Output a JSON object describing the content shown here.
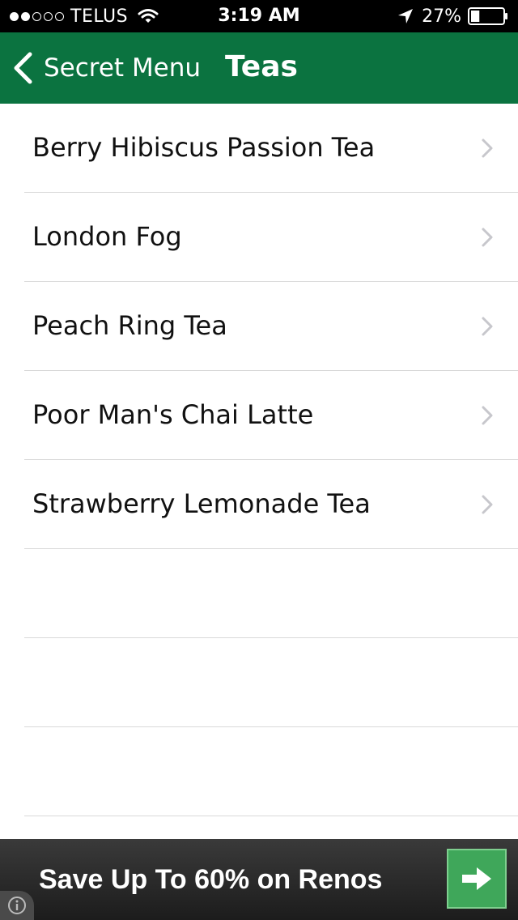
{
  "status_bar": {
    "signal_full": 2,
    "signal_total": 5,
    "carrier": "TELUS",
    "time": "3:19 AM",
    "battery_percent": "27%",
    "battery_level": 0.27,
    "icons": [
      "wifi-icon",
      "location-arrow-icon",
      "battery-icon"
    ]
  },
  "nav": {
    "back_label": "Secret Menu",
    "title": "Teas",
    "color": "#0b7340",
    "back_icon": "chevron-left-icon"
  },
  "list": {
    "items": [
      {
        "label": "Berry Hibiscus Passion Tea"
      },
      {
        "label": "London Fog"
      },
      {
        "label": "Peach Ring Tea"
      },
      {
        "label": "Poor Man's Chai Latte"
      },
      {
        "label": "Strawberry Lemonade Tea"
      }
    ],
    "row_icon": "chevron-right-icon",
    "separator_color": "#d9d9d9"
  },
  "ad": {
    "text": "Save Up To 60% on Renos",
    "button_icon": "arrow-right-icon",
    "button_color": "#3fa75a",
    "info_icon": "info-icon"
  }
}
